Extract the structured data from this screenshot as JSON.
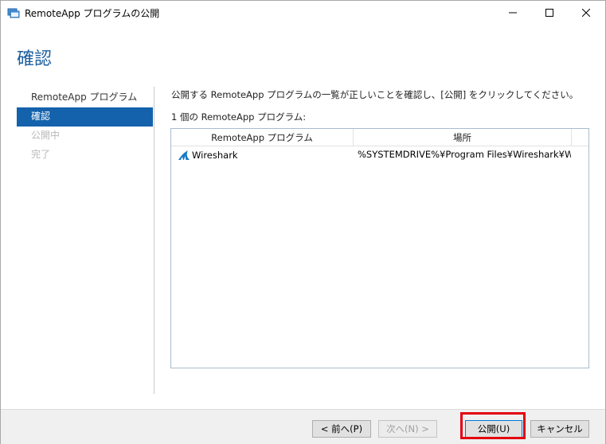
{
  "window": {
    "title": "RemoteApp プログラムの公開",
    "icon": "remoteapp-icon",
    "controls": {
      "minimize": "minimize-icon",
      "maximize": "maximize-icon",
      "close": "close-icon"
    }
  },
  "page": {
    "title": "確認"
  },
  "nav": {
    "items": [
      {
        "label": "RemoteApp プログラム",
        "state": "normal"
      },
      {
        "label": "確認",
        "state": "selected"
      },
      {
        "label": "公開中",
        "state": "disabled"
      },
      {
        "label": "完了",
        "state": "disabled"
      }
    ]
  },
  "content": {
    "instruction": "公開する RemoteApp プログラムの一覧が正しいことを確認し、[公開] をクリックしてください。",
    "count_label": "1 個の RemoteApp プログラム:",
    "table": {
      "columns": [
        "RemoteApp プログラム",
        "場所"
      ],
      "rows": [
        {
          "name": "Wireshark",
          "icon": "wireshark-icon",
          "location": "%SYSTEMDRIVE%¥Program Files¥Wireshark¥Wi..."
        }
      ]
    }
  },
  "footer": {
    "back_label": "< 前へ(P)",
    "next_label": "次へ(N) >",
    "publish_label": "公開(U)",
    "cancel_label": "キャンセル"
  },
  "colors": {
    "accent": "#1462ac",
    "title": "#1b5e9f",
    "highlight": "#e3000f"
  }
}
